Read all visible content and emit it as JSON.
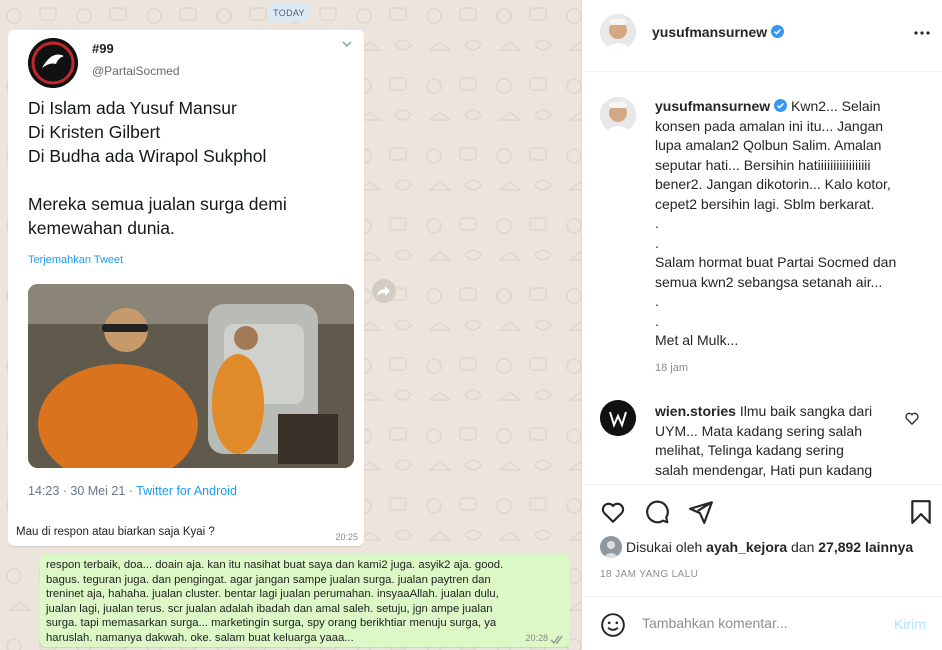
{
  "whatsapp": {
    "date_chip": "TODAY",
    "tweet": {
      "name": "#99",
      "handle": "@PartaiSocmed",
      "lines": [
        "Di Islam ada Yusuf Mansur",
        "Di Kristen Gilbert",
        "Di Budha ada Wirapol Sukphol"
      ],
      "lines2": [
        "Mereka semua jualan surga demi",
        "kemewahan dunia."
      ],
      "translate": "Terjemahkan Tweet",
      "meta_time": "14:23 · 30 Mei 21 · ",
      "meta_source": "Twitter for Android"
    },
    "incoming_caption": "Mau di respon atau biarkan saja Kyai ?",
    "incoming_time": "20:25",
    "outgoing_lines": [
      "respon terbaik, doa... doain aja. kan itu nasihat buat saya dan kami2 juga. asyik2 aja. good.",
      "bagus. teguran juga. dan pengingat. agar jangan sampe jualan surga. jualan paytren dan",
      "treninet aja, hahaha. jualan cluster. bentar lagi jualan perumahan. insyaaAllah. jualan dulu,",
      "jualan lagi, jualan terus. scr jualan adalah ibadah dan amal saleh. setuju, jgn ampe jualan",
      "surga. tapi memasarkan surga... marketingin surga, spy orang berikhtiar menuju surga, ya",
      "haruslah. namanya dakwah. oke. salam buat keluarga yaaa..."
    ],
    "outgoing_time": "20:28"
  },
  "instagram": {
    "header_username": "yusufmansurnew",
    "caption_username": "yusufmansurnew",
    "caption_lines": [
      "Kwn2... Selain",
      "konsen pada amalan ini itu... Jangan",
      "lupa amalan2 Qolbun Salim. Amalan",
      "seputar hati... Bersihin hatiiiiiiiiiiiiiiiii",
      "bener2. Jangan dikotorin... Kalo kotor,",
      "cepet2 bersihin lagi. Sblm berkarat.",
      ".",
      ".",
      "Salam hormat buat Partai Socmed dan",
      "semua kwn2 sebangsa setanah air...",
      ".",
      ".",
      "Met al Mulk..."
    ],
    "caption_time": "18 jam",
    "comment_username": "wien.stories",
    "comment_lines": [
      "Ilmu baik sangka dari",
      "UYM... Mata kadang sering salah",
      "melihat, Telinga kadang sering",
      "salah mendengar, Hati pun kadang"
    ],
    "likes_prefix": "Disukai oleh ",
    "likes_user": "ayah_kejora",
    "likes_mid": " dan ",
    "likes_count": "27,892 lainnya",
    "post_date": "18 JAM YANG LALU",
    "comment_placeholder": "Tambahkan komentar...",
    "post_button": "Kirim"
  },
  "colors": {
    "chat_bg": "#ece5dd",
    "outgoing_bubble": "#dcf8c6",
    "twitter_blue": "#1d9bf0",
    "ig_verified": "#3897f0"
  },
  "icons": [
    "forward-icon",
    "chevron-down-icon",
    "verified-badge-icon",
    "more-options-icon",
    "heart-icon",
    "comment-icon",
    "share-icon",
    "bookmark-icon",
    "emoji-icon"
  ]
}
